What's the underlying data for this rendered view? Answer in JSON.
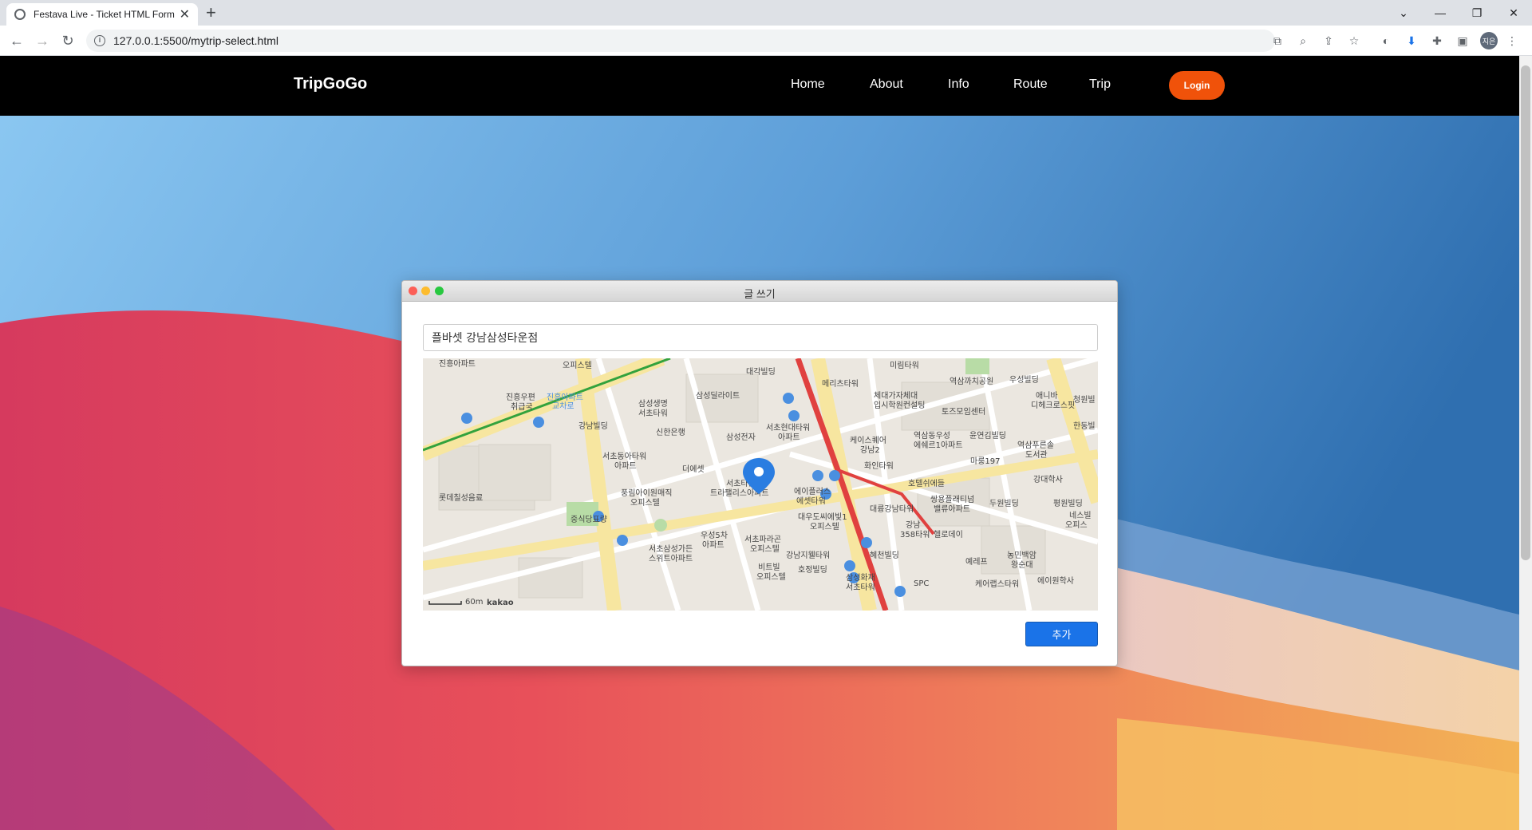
{
  "browser": {
    "tab_title": "Festava Live - Ticket HTML Form",
    "url": "127.0.0.1:5500/mytrip-select.html",
    "profile_initials": "지은"
  },
  "header": {
    "logo": "TripGoGo",
    "nav": [
      "Home",
      "About",
      "Info",
      "Route",
      "Trip"
    ],
    "login_label": "Login",
    "accent_color": "#f0520a"
  },
  "dialog": {
    "window_title": "글 쓰기",
    "title_input_value": "플바셋 강남삼성타운점",
    "add_button_label": "추가"
  },
  "map": {
    "provider": "kakao",
    "scale_label": "60m",
    "labels": [
      "진흥아파트",
      "오피스텔",
      "대각빌딩",
      "미림타워",
      "역삼까치공원",
      "우성빌딩",
      "진흥우편취급국",
      "진흥아파트교차로",
      "삼성생명서초타워",
      "삼성딜라이트",
      "메리츠타워",
      "체대가자체대입시학원컨설팅",
      "토즈모임센터",
      "애니바디헤크로스핏",
      "청원빌딩",
      "강남빌딩",
      "신한은행",
      "서초현대타워아파트",
      "삼성전자",
      "케이스퀘어강남2",
      "역삼동우성에쉐르1아파트",
      "윤연김빌딩",
      "역삼푸른솔도서관",
      "한동빌딩",
      "서초동아타워아파트",
      "더에셋",
      "화인타워",
      "마룽197",
      "강대학사",
      "롯데칠성음료",
      "풍림아이원매직오피스텔",
      "서초타운트라팰리스아파트",
      "에이플러스에셋타워",
      "호텔쉬에들",
      "쌍용플래티넘밸류아파트",
      "두원빌딩",
      "평원빌딩",
      "네스빌오피스텔",
      "중식당표량",
      "대우도씨에빛1오피스텔",
      "대륭강남타워",
      "강남358타워",
      "헬로데이",
      "서초삼성가든스위트아파트",
      "우성5차아파트",
      "서초파라곤오피스텔",
      "강남지웰타워",
      "혜천빌딩",
      "예레프",
      "농민백암왕순대",
      "비트빌오피스텔",
      "호정빌딩",
      "삼성화재서초타워",
      "SPC",
      "케어랩스타워",
      "에이원학사"
    ]
  }
}
